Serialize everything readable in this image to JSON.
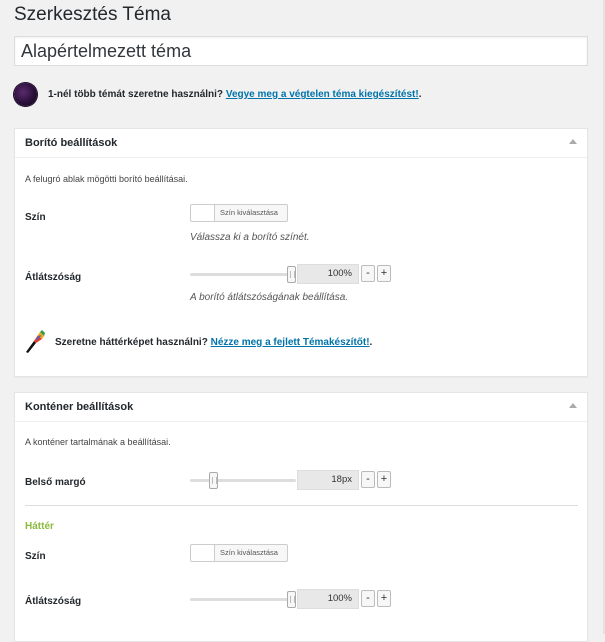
{
  "page": {
    "title": "Szerkesztés Téma"
  },
  "title_field": {
    "value": "Alapértelmezett téma"
  },
  "promo_unlimited": {
    "text": "1-nél több témát szeretne használni?",
    "link": "Vegye meg a végtelen téma kiegészítést!",
    "suffix": ".",
    "icon": "planet-icon"
  },
  "overlay_box": {
    "title": "Borító beállítások",
    "description": "A felugró ablak mögötti borító beállításai.",
    "color": {
      "label": "Szín",
      "picker_label": "Szín kiválasztása",
      "help": "Válassza ki a borító színét."
    },
    "opacity": {
      "label": "Átlátszóság",
      "value": "100%",
      "level": 1.0,
      "help": "A borító átlátszóságának beállítása.",
      "minus": "-",
      "plus": "+"
    },
    "promo": {
      "text": "Szeretne háttérképet használni?",
      "link": "Nézze meg a fejlett Témakészítőt!",
      "suffix": ".",
      "icon": "paintbrush-icon"
    }
  },
  "container_box": {
    "title": "Konténer beállítások",
    "description": "A konténer tartalmának a beállításai.",
    "padding": {
      "label": "Belső margó",
      "value": "18px",
      "level": 0.2,
      "minus": "-",
      "plus": "+"
    },
    "background_heading": "Háttér",
    "color": {
      "label": "Szín",
      "picker_label": "Szín kiválasztása"
    },
    "opacity": {
      "label": "Átlátszóság",
      "value": "100%",
      "level": 1.0,
      "minus": "-",
      "plus": "+"
    }
  },
  "colors": {
    "accent_green": "#8cba3d",
    "link_blue": "#0073aa"
  }
}
